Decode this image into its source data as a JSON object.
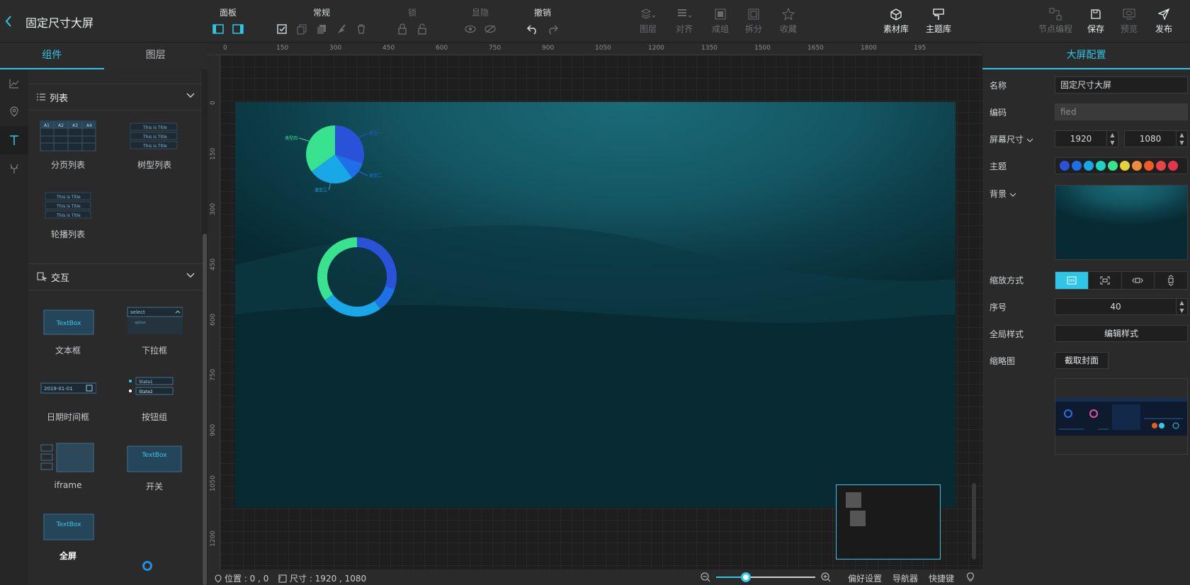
{
  "header": {
    "title": "固定尺寸大屏",
    "groups": [
      {
        "label": "面板",
        "dim": false
      },
      {
        "label": "常规",
        "dim": false
      },
      {
        "label": "锁",
        "dim": true
      },
      {
        "label": "显隐",
        "dim": true
      },
      {
        "label": "撤销",
        "dim": false
      }
    ],
    "tools": [
      {
        "label": "图层",
        "icon": "layers-icon",
        "dim": true
      },
      {
        "label": "对齐",
        "icon": "align-icon",
        "dim": true
      },
      {
        "label": "成组",
        "icon": "group-icon",
        "dim": true
      },
      {
        "label": "拆分",
        "icon": "ungroup-icon",
        "dim": true
      },
      {
        "label": "收藏",
        "icon": "star-icon",
        "dim": true
      },
      {
        "label": "素材库",
        "icon": "package-icon",
        "dim": false
      },
      {
        "label": "主题库",
        "icon": "brush-icon",
        "dim": false
      },
      {
        "label": "节点编程",
        "icon": "node-icon",
        "dim": true
      },
      {
        "label": "保存",
        "icon": "save-icon",
        "dim": false
      },
      {
        "label": "预览",
        "icon": "preview-icon",
        "dim": true
      },
      {
        "label": "发布",
        "icon": "send-icon",
        "dim": false
      }
    ]
  },
  "left": {
    "tabs": [
      "组件",
      "图层"
    ],
    "sections": {
      "list": {
        "title": "列表",
        "items": [
          "分页列表",
          "树型列表",
          "轮播列表"
        ],
        "table_headers": [
          "A1",
          "A2",
          "A3",
          "A4"
        ],
        "row_text": "This is Title"
      },
      "interact": {
        "title": "交互",
        "items": [
          "文本框",
          "下拉框",
          "日期时间框",
          "按钮组",
          "iframe",
          "开关",
          "全屏"
        ],
        "textbox_text": "TextBox",
        "select_text": "select",
        "option_text": "option",
        "date_text": "2019-01-01",
        "states": [
          "State1",
          "State2"
        ]
      }
    }
  },
  "rulers": {
    "top": [
      "0",
      "150",
      "300",
      "450",
      "600",
      "750",
      "900",
      "1050",
      "1200",
      "1350",
      "1500",
      "1650",
      "1800",
      "195"
    ],
    "left": [
      "0",
      "150",
      "300",
      "450",
      "600",
      "750",
      "900",
      "1050",
      "1200"
    ]
  },
  "status": {
    "position_label": "位置 : 0 , 0",
    "size_label": "尺寸 : 1920 , 1080",
    "zoom_fraction": 0.3,
    "links": [
      "偏好设置",
      "导航器",
      "快捷键"
    ]
  },
  "canvas": {
    "pie_labels": [
      "类型一",
      "类型二",
      "类型三",
      "类型四"
    ],
    "pie_values": [
      30,
      10,
      25,
      35
    ],
    "donut_values": [
      30,
      10,
      25,
      35
    ],
    "colors": [
      "#2a52d9",
      "#1f6fe8",
      "#18a8e8",
      "#21d3c2",
      "#38e28f"
    ]
  },
  "right": {
    "title": "大屏配置",
    "fields": {
      "name_label": "名称",
      "name_value": "固定尺寸大屏",
      "code_label": "编码",
      "code_value": "fied",
      "size_label": "屏幕尺寸",
      "width": "1920",
      "height": "1080",
      "theme_label": "主题",
      "theme_colors": [
        "#2a52d9",
        "#1f6fe8",
        "#18a8e8",
        "#21d3c2",
        "#38e28f",
        "#e8d23a",
        "#f08a3c",
        "#f05a28",
        "#e84646",
        "#e8334d"
      ],
      "bg_label": "背景",
      "scale_label": "缩放方式",
      "order_label": "序号",
      "order_value": "40",
      "global_style_label": "全局样式",
      "edit_style_button": "编辑样式",
      "thumb_label": "缩略图",
      "capture_button": "截取封面"
    }
  }
}
